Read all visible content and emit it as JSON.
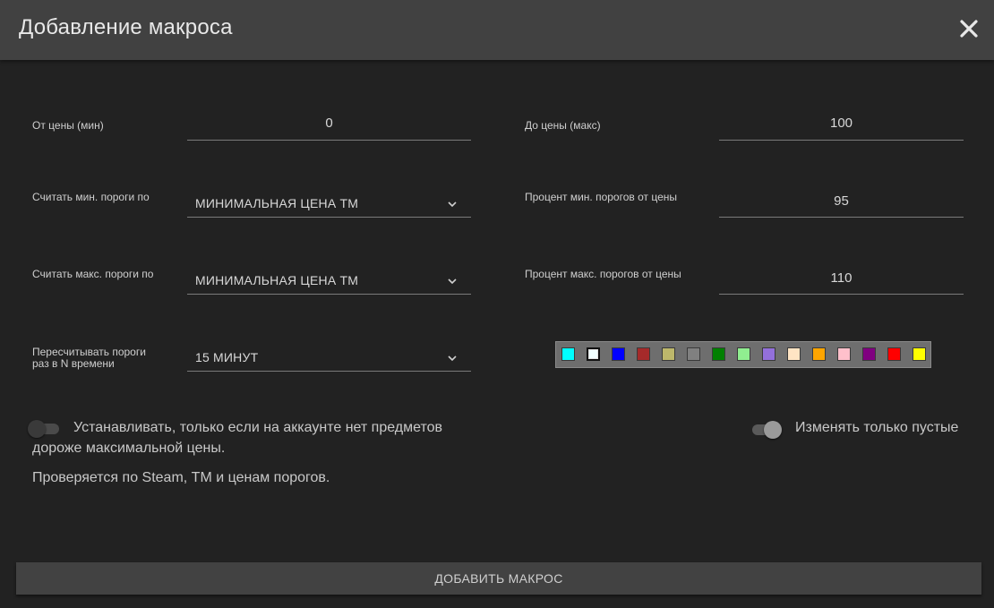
{
  "dialog": {
    "title": "Добавление макроса",
    "close_icon": "close-icon"
  },
  "form": {
    "price_min": {
      "label": "От цены (мин)",
      "value": "0"
    },
    "price_max": {
      "label": "До цены (макс)",
      "value": "100"
    },
    "min_threshold_basis": {
      "label": "Считать мин. пороги по",
      "value": "МИНИМАЛЬНАЯ ЦЕНА ТМ"
    },
    "min_threshold_percent": {
      "label": "Процент мин. порогов от цены",
      "value": "95"
    },
    "max_threshold_basis": {
      "label": "Считать макс. пороги по",
      "value": "МИНИМАЛЬНАЯ ЦЕНА ТМ"
    },
    "max_threshold_percent": {
      "label": "Процент макс. порогов от цены",
      "value": "110"
    },
    "recalc_interval": {
      "label_line1": "Пересчитывать пороги",
      "label_line2": "раз в N времени",
      "value": "15 МИНУТ"
    }
  },
  "palette": {
    "colors": [
      "#00ffff",
      "#f0ffff",
      "#0000ff",
      "#a52a2a",
      "#bdb76b",
      "#808080",
      "#008000",
      "#90ee90",
      "#9370db",
      "#ffe4c4",
      "#ffa500",
      "#ffc0cb",
      "#800080",
      "#ff0000",
      "#ffff00"
    ],
    "selected_index": 1
  },
  "toggles": {
    "only_if_no_expensive": {
      "line1": "Устанавливать, только если на аккаунте нет предметов",
      "line2": "дороже максимальной цены.",
      "state": "off"
    },
    "only_empty": {
      "label": "Изменять только пустые",
      "state": "on"
    }
  },
  "note": "Проверяется по Steam, ТМ и ценам порогов.",
  "submit_label": "ДОБАВИТЬ МАКРОС",
  "colors": {
    "background": "#222222",
    "header": "#414141",
    "button": "#424242"
  }
}
